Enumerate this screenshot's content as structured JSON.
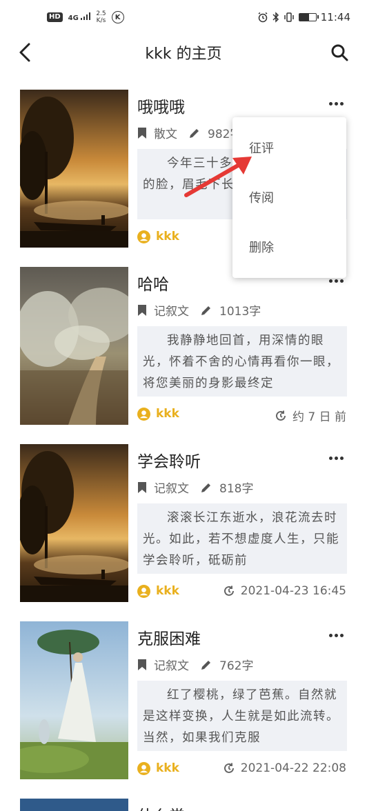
{
  "status_bar": {
    "hd": "HD",
    "network": "4G",
    "speed_value": "2.5",
    "speed_unit": "K/s",
    "k_badge": "K",
    "time": "11:44",
    "battery_level": 0.6
  },
  "header": {
    "title": "kkk 的主页",
    "back_icon": "chevron-left-icon",
    "search_icon": "search-icon"
  },
  "articles": [
    {
      "title": "哦哦哦",
      "genre": "散文",
      "word_count": "982字",
      "excerpt": "今年三十多了，我个子，黝黑的脸，眉毛下长着一双眼睛",
      "author": "kkk",
      "time": ""
    },
    {
      "title": "哈哈",
      "genre": "记叙文",
      "word_count": "1013字",
      "excerpt": "我静静地回首，用深情的眼光，怀着不舍的心情再看你一眼，将您美丽的身影最终定",
      "author": "kkk",
      "time": "约 7 日 前"
    },
    {
      "title": "学会聆听",
      "genre": "记叙文",
      "word_count": "818字",
      "excerpt": "滚滚长江东逝水，浪花流去时光。如此，若不想虚度人生，只能学会聆听，砥砺前",
      "author": "kkk",
      "time": "2021-04-23 16:45"
    },
    {
      "title": "克服困难",
      "genre": "记叙文",
      "word_count": "762字",
      "excerpt": "红了樱桃，绿了芭蕉。自然就是这样变换，人生就是如此流转。当然，如果我们克服",
      "author": "kkk",
      "time": "2021-04-22 22:08"
    },
    {
      "title": "什么常"
    }
  ],
  "popup_menu": {
    "items": [
      "征评",
      "传阅",
      "删除"
    ]
  },
  "colors": {
    "author": "#e9b01e",
    "excerpt_bg": "#eff1f5",
    "annotation_arrow": "#e53935"
  }
}
